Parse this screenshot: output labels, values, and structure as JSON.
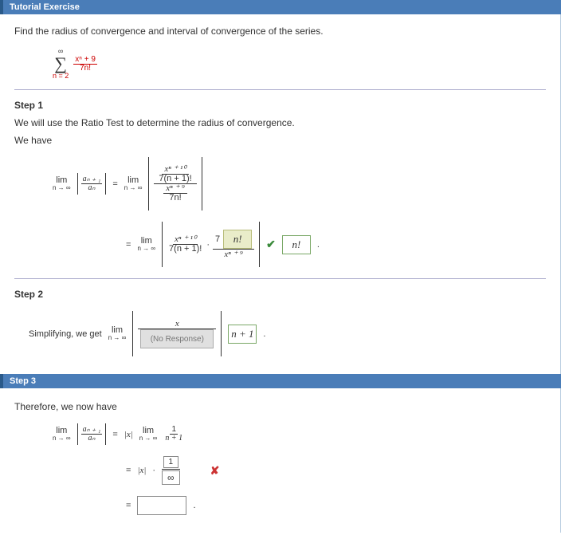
{
  "header": {
    "title": "Tutorial Exercise"
  },
  "prompt": "Find the radius of convergence and interval of convergence of the series.",
  "series": {
    "top": "∞",
    "bottom": "n = 2",
    "num": "xⁿ + 9",
    "den": "7n!"
  },
  "step1": {
    "title": "Step 1",
    "line1": "We will use the Ratio Test to determine the radius of convergence.",
    "line2": "We have",
    "lim": "lim",
    "limsub": "n → ∞",
    "ratio_num": "aₙ ₊ ₁",
    "ratio_den": "aₙ",
    "eq": "=",
    "rhs1_num_top": "xⁿ ⁺ ¹⁰",
    "rhs1_num_bot": "7(n + 1)!",
    "rhs1_den_top": "xⁿ ⁺ ⁹",
    "rhs1_den_bot": "7n!",
    "row2_frac_num": "xⁿ ⁺ ¹⁰",
    "row2_frac_den": "7(n + 1)!",
    "dot": "·",
    "seven": "7",
    "ans1": "n!",
    "ans2": "n!",
    "row2_den": "xⁿ ⁺ ⁹"
  },
  "step2": {
    "title": "Step 2",
    "text": "Simplifying, we get",
    "lim": "lim",
    "limsub": "n → ∞",
    "var": "x",
    "noresp": "(No Response)",
    "ans": "n + 1",
    "dot": "."
  },
  "step3": {
    "title": "Step 3",
    "text": "Therefore, we now have",
    "lim": "lim",
    "limsub": "n → ∞",
    "ratio_num": "aₙ ₊ ₁",
    "ratio_den": "aₙ",
    "eq": "=",
    "absx": "|x|",
    "rhs_num": "1",
    "rhs_den": "n + 1",
    "dot": "·",
    "box_top": "1",
    "box_bot": "∞"
  }
}
